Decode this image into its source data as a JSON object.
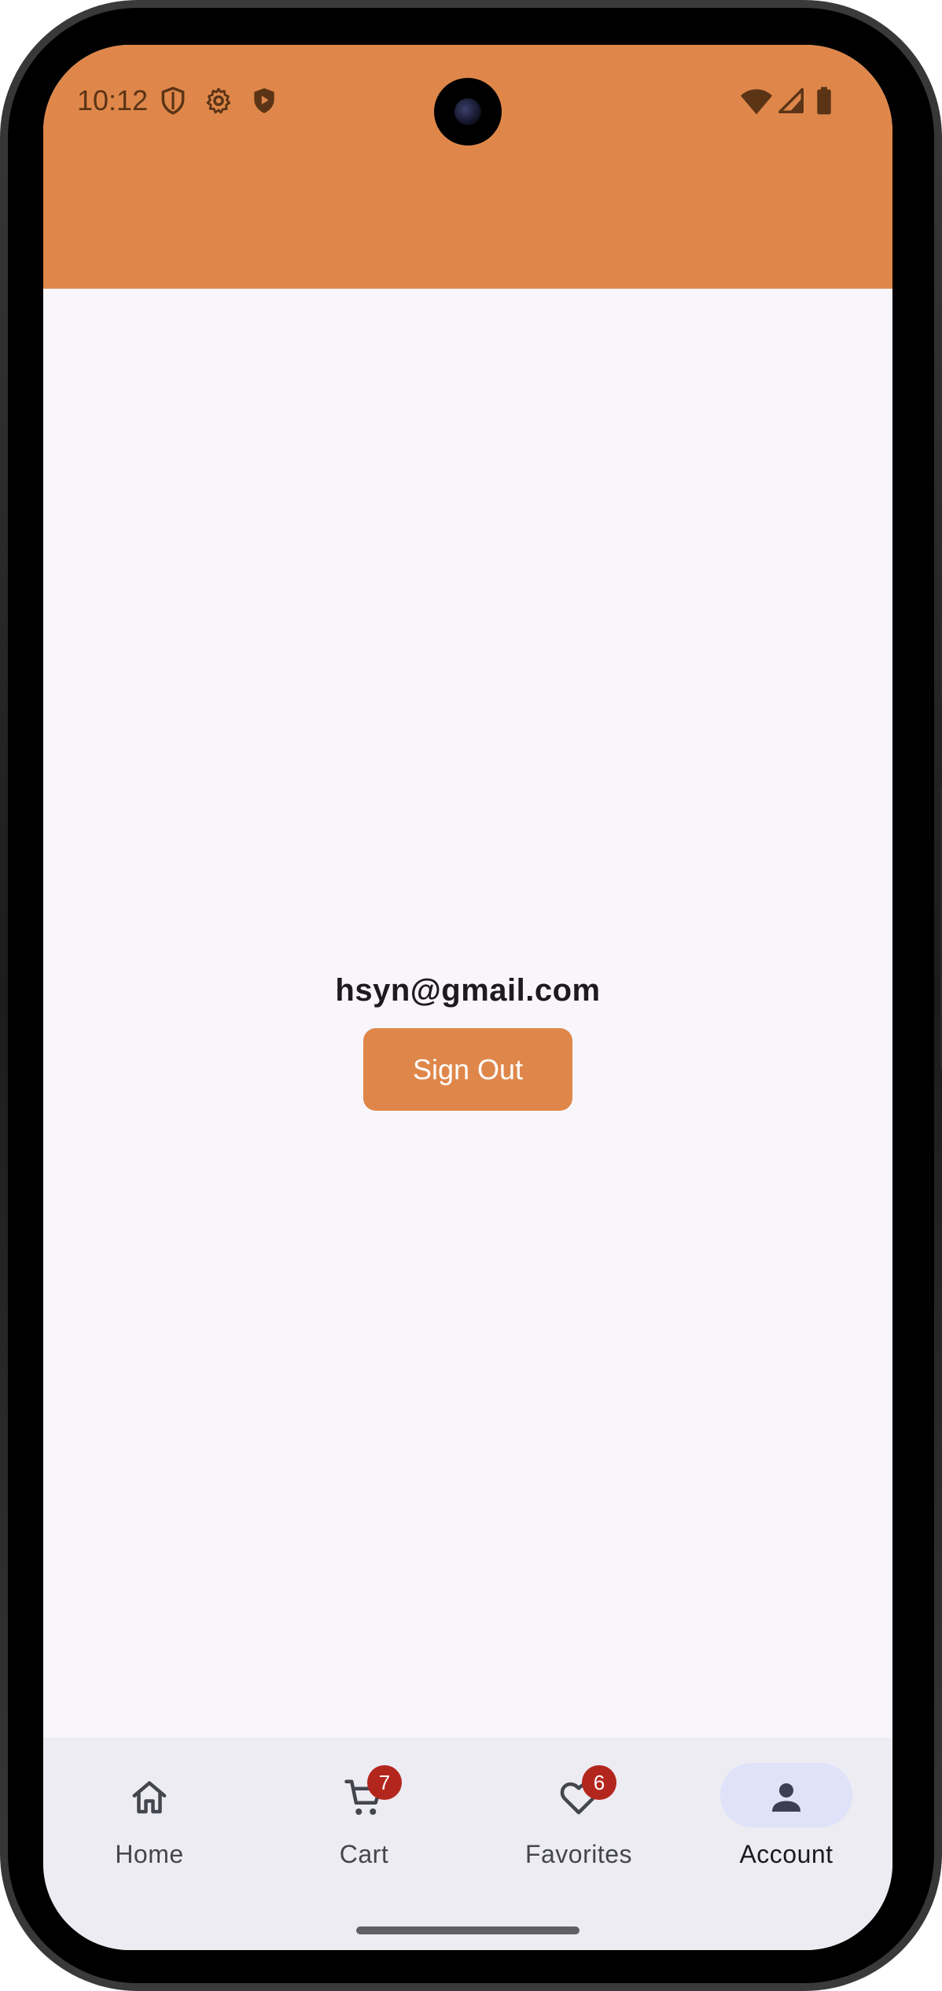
{
  "status_bar": {
    "time": "10:12",
    "left_icons": [
      "shield-outline-icon",
      "gear-icon",
      "shield-play-icon"
    ],
    "right_icons": [
      "wifi-icon",
      "cell-signal-icon",
      "battery-icon"
    ]
  },
  "account": {
    "email": "hsyn@gmail.com",
    "sign_out_label": "Sign Out"
  },
  "bottom_nav": {
    "items": [
      {
        "label": "Home",
        "icon": "home-icon",
        "active": false
      },
      {
        "label": "Cart",
        "icon": "cart-icon",
        "active": false,
        "badge": "7"
      },
      {
        "label": "Favorites",
        "icon": "heart-icon",
        "active": false,
        "badge": "6"
      },
      {
        "label": "Account",
        "icon": "person-icon",
        "active": true
      }
    ]
  },
  "colors": {
    "accent": "#df874a",
    "background": "#f8f6fb",
    "nav_background": "#edecf2",
    "active_pill": "#dfe2f8",
    "badge": "#b3261e"
  }
}
